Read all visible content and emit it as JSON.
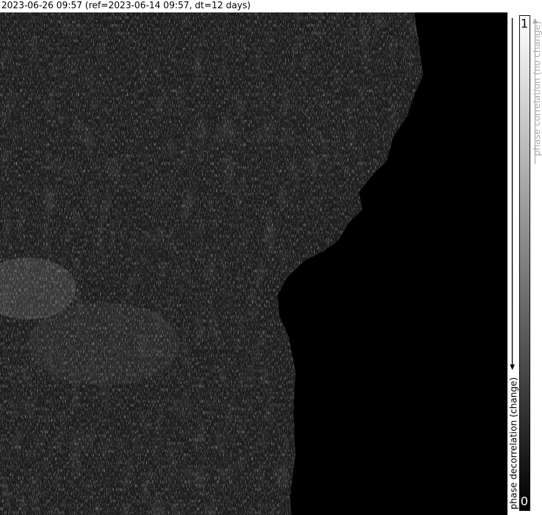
{
  "header": {
    "title": "2023-06-26 09:57 (ref=2023-06-14 09:57, dt=12 days)"
  },
  "colorbar": {
    "max_tick": "1",
    "min_tick": "0",
    "top_label": "phase correlation (no change)",
    "bottom_label": "phase decorrelation (change)",
    "colors": {
      "top": "#ffffff",
      "bottom": "#000000",
      "top_label": "#aaaaaa",
      "bottom_label": "#000000"
    }
  },
  "image": {
    "background": "#000000"
  }
}
